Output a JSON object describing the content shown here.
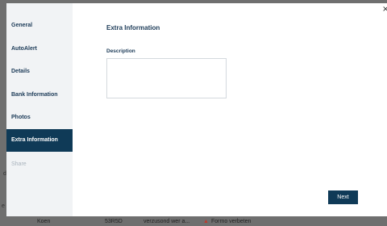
{
  "modal": {
    "close_glyph": "×",
    "title": "Extra Information",
    "description_label": "Description",
    "description_value": "",
    "next_label": "Next"
  },
  "sidebar": {
    "items": [
      {
        "label": "General",
        "state": "default"
      },
      {
        "label": "AutoAlert",
        "state": "default"
      },
      {
        "label": "Details",
        "state": "default"
      },
      {
        "label": "Bank Information",
        "state": "default"
      },
      {
        "label": "Photos",
        "state": "default"
      },
      {
        "label": "Extra Information",
        "state": "active"
      },
      {
        "label": "Share",
        "state": "disabled"
      }
    ]
  },
  "background": {
    "row": [
      "Koen",
      "53R5D",
      "verzusond wer a...",
      "▲",
      "Formo verbeten"
    ],
    "side_d": "d",
    "side_e": "e"
  },
  "colors": {
    "accent": "#0f3a57",
    "sidebar_bg": "#f1f3f5",
    "disabled_text": "#a9b3bd"
  }
}
